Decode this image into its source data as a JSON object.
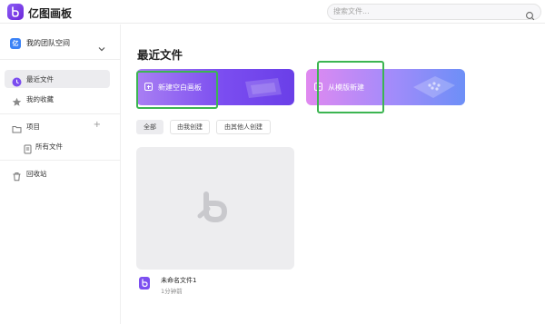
{
  "app": {
    "title": "亿图画板"
  },
  "search": {
    "placeholder": "搜索文件..."
  },
  "sidebar": {
    "team": {
      "badge": "亿",
      "label": "我的团队空间"
    },
    "items": [
      {
        "label": "最近文件",
        "icon": "clock-icon",
        "active": true
      },
      {
        "label": "我的收藏",
        "icon": "star-icon"
      },
      {
        "label": "项目",
        "icon": "folder-icon",
        "action": "+"
      },
      {
        "label": "所有文件",
        "icon": "file-icon"
      },
      {
        "label": "回收站",
        "icon": "trash-icon"
      }
    ]
  },
  "main": {
    "title": "最近文件",
    "cards": [
      {
        "label": "新建空白画板",
        "icon": "plus-square-icon"
      },
      {
        "label": "从模版新建",
        "icon": "plus-square-icon"
      }
    ],
    "filters": [
      {
        "label": "全部",
        "active": true
      },
      {
        "label": "由我创建"
      },
      {
        "label": "由其他人创建"
      }
    ],
    "files": [
      {
        "name": "未命名文件1",
        "time": "1分钟前"
      }
    ]
  },
  "colors": {
    "accent": "#7b4df0",
    "highlight": "#3cb551",
    "active_bg": "#ececef"
  }
}
